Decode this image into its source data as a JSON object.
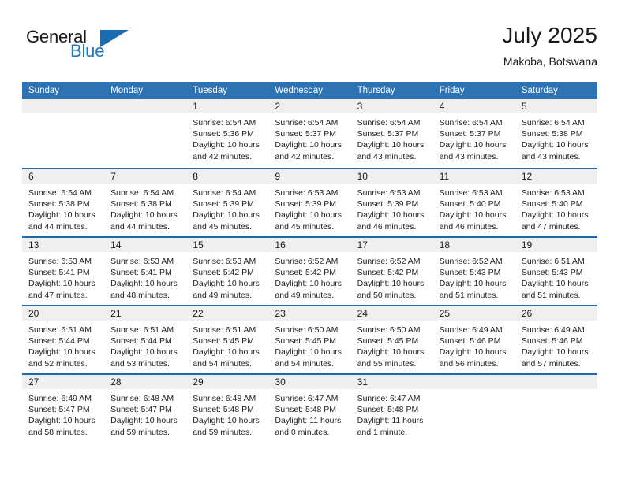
{
  "brand": {
    "name_part1": "General",
    "name_part2": "Blue",
    "triangle_color": "#1b6cb3",
    "blue_text_color": "#1c78c0"
  },
  "header": {
    "month_title": "July 2025",
    "location": "Makoba, Botswana"
  },
  "theme": {
    "header_blue": "#2d72b2",
    "week_divider_blue": "#1f68ac",
    "day_band_gray": "#efefef"
  },
  "calendar": {
    "weekdays": [
      "Sunday",
      "Monday",
      "Tuesday",
      "Wednesday",
      "Thursday",
      "Friday",
      "Saturday"
    ],
    "weeks": [
      [
        {
          "day": "",
          "lines": []
        },
        {
          "day": "",
          "lines": []
        },
        {
          "day": "1",
          "lines": [
            "Sunrise: 6:54 AM",
            "Sunset: 5:36 PM",
            "Daylight: 10 hours",
            "and 42 minutes."
          ]
        },
        {
          "day": "2",
          "lines": [
            "Sunrise: 6:54 AM",
            "Sunset: 5:37 PM",
            "Daylight: 10 hours",
            "and 42 minutes."
          ]
        },
        {
          "day": "3",
          "lines": [
            "Sunrise: 6:54 AM",
            "Sunset: 5:37 PM",
            "Daylight: 10 hours",
            "and 43 minutes."
          ]
        },
        {
          "day": "4",
          "lines": [
            "Sunrise: 6:54 AM",
            "Sunset: 5:37 PM",
            "Daylight: 10 hours",
            "and 43 minutes."
          ]
        },
        {
          "day": "5",
          "lines": [
            "Sunrise: 6:54 AM",
            "Sunset: 5:38 PM",
            "Daylight: 10 hours",
            "and 43 minutes."
          ]
        }
      ],
      [
        {
          "day": "6",
          "lines": [
            "Sunrise: 6:54 AM",
            "Sunset: 5:38 PM",
            "Daylight: 10 hours",
            "and 44 minutes."
          ]
        },
        {
          "day": "7",
          "lines": [
            "Sunrise: 6:54 AM",
            "Sunset: 5:38 PM",
            "Daylight: 10 hours",
            "and 44 minutes."
          ]
        },
        {
          "day": "8",
          "lines": [
            "Sunrise: 6:54 AM",
            "Sunset: 5:39 PM",
            "Daylight: 10 hours",
            "and 45 minutes."
          ]
        },
        {
          "day": "9",
          "lines": [
            "Sunrise: 6:53 AM",
            "Sunset: 5:39 PM",
            "Daylight: 10 hours",
            "and 45 minutes."
          ]
        },
        {
          "day": "10",
          "lines": [
            "Sunrise: 6:53 AM",
            "Sunset: 5:39 PM",
            "Daylight: 10 hours",
            "and 46 minutes."
          ]
        },
        {
          "day": "11",
          "lines": [
            "Sunrise: 6:53 AM",
            "Sunset: 5:40 PM",
            "Daylight: 10 hours",
            "and 46 minutes."
          ]
        },
        {
          "day": "12",
          "lines": [
            "Sunrise: 6:53 AM",
            "Sunset: 5:40 PM",
            "Daylight: 10 hours",
            "and 47 minutes."
          ]
        }
      ],
      [
        {
          "day": "13",
          "lines": [
            "Sunrise: 6:53 AM",
            "Sunset: 5:41 PM",
            "Daylight: 10 hours",
            "and 47 minutes."
          ]
        },
        {
          "day": "14",
          "lines": [
            "Sunrise: 6:53 AM",
            "Sunset: 5:41 PM",
            "Daylight: 10 hours",
            "and 48 minutes."
          ]
        },
        {
          "day": "15",
          "lines": [
            "Sunrise: 6:53 AM",
            "Sunset: 5:42 PM",
            "Daylight: 10 hours",
            "and 49 minutes."
          ]
        },
        {
          "day": "16",
          "lines": [
            "Sunrise: 6:52 AM",
            "Sunset: 5:42 PM",
            "Daylight: 10 hours",
            "and 49 minutes."
          ]
        },
        {
          "day": "17",
          "lines": [
            "Sunrise: 6:52 AM",
            "Sunset: 5:42 PM",
            "Daylight: 10 hours",
            "and 50 minutes."
          ]
        },
        {
          "day": "18",
          "lines": [
            "Sunrise: 6:52 AM",
            "Sunset: 5:43 PM",
            "Daylight: 10 hours",
            "and 51 minutes."
          ]
        },
        {
          "day": "19",
          "lines": [
            "Sunrise: 6:51 AM",
            "Sunset: 5:43 PM",
            "Daylight: 10 hours",
            "and 51 minutes."
          ]
        }
      ],
      [
        {
          "day": "20",
          "lines": [
            "Sunrise: 6:51 AM",
            "Sunset: 5:44 PM",
            "Daylight: 10 hours",
            "and 52 minutes."
          ]
        },
        {
          "day": "21",
          "lines": [
            "Sunrise: 6:51 AM",
            "Sunset: 5:44 PM",
            "Daylight: 10 hours",
            "and 53 minutes."
          ]
        },
        {
          "day": "22",
          "lines": [
            "Sunrise: 6:51 AM",
            "Sunset: 5:45 PM",
            "Daylight: 10 hours",
            "and 54 minutes."
          ]
        },
        {
          "day": "23",
          "lines": [
            "Sunrise: 6:50 AM",
            "Sunset: 5:45 PM",
            "Daylight: 10 hours",
            "and 54 minutes."
          ]
        },
        {
          "day": "24",
          "lines": [
            "Sunrise: 6:50 AM",
            "Sunset: 5:45 PM",
            "Daylight: 10 hours",
            "and 55 minutes."
          ]
        },
        {
          "day": "25",
          "lines": [
            "Sunrise: 6:49 AM",
            "Sunset: 5:46 PM",
            "Daylight: 10 hours",
            "and 56 minutes."
          ]
        },
        {
          "day": "26",
          "lines": [
            "Sunrise: 6:49 AM",
            "Sunset: 5:46 PM",
            "Daylight: 10 hours",
            "and 57 minutes."
          ]
        }
      ],
      [
        {
          "day": "27",
          "lines": [
            "Sunrise: 6:49 AM",
            "Sunset: 5:47 PM",
            "Daylight: 10 hours",
            "and 58 minutes."
          ]
        },
        {
          "day": "28",
          "lines": [
            "Sunrise: 6:48 AM",
            "Sunset: 5:47 PM",
            "Daylight: 10 hours",
            "and 59 minutes."
          ]
        },
        {
          "day": "29",
          "lines": [
            "Sunrise: 6:48 AM",
            "Sunset: 5:48 PM",
            "Daylight: 10 hours",
            "and 59 minutes."
          ]
        },
        {
          "day": "30",
          "lines": [
            "Sunrise: 6:47 AM",
            "Sunset: 5:48 PM",
            "Daylight: 11 hours",
            "and 0 minutes."
          ]
        },
        {
          "day": "31",
          "lines": [
            "Sunrise: 6:47 AM",
            "Sunset: 5:48 PM",
            "Daylight: 11 hours",
            "and 1 minute."
          ]
        },
        {
          "day": "",
          "lines": []
        },
        {
          "day": "",
          "lines": []
        }
      ]
    ]
  }
}
